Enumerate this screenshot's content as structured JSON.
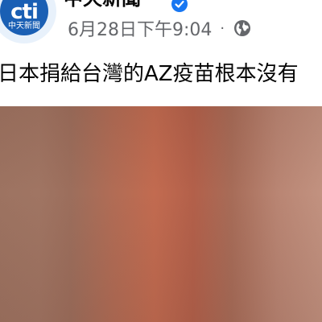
{
  "page": {
    "name": "中天新聞",
    "logo_text": "cti",
    "logo_subtext": "中天新聞",
    "timestamp": "6月28日下午9:04",
    "separator": "·",
    "visibility_icon": "globe-icon",
    "verified_icon": "verified-badge-icon"
  },
  "post": {
    "text": "日本捐給台灣的AZ疫苗根本沒有"
  },
  "colors": {
    "brand_blue": "#1a5fb4",
    "verified_blue": "#1877f2",
    "meta_gray": "#65676b",
    "text_black": "#050505"
  }
}
